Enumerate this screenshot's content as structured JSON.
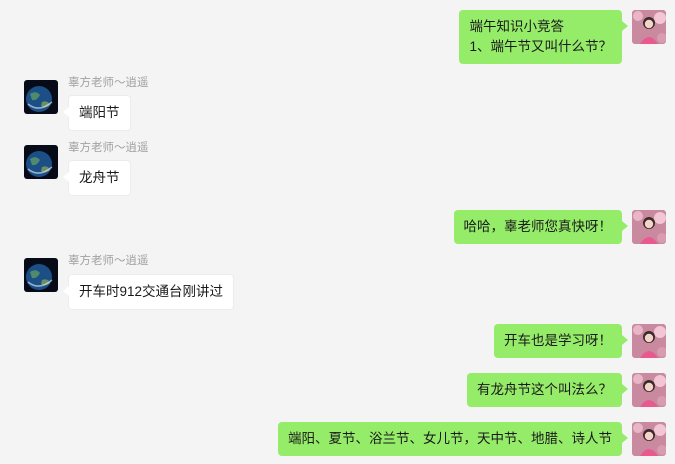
{
  "colors": {
    "background": "#f4f4f4",
    "outgoing_bubble": "#95ec69",
    "incoming_bubble": "#ffffff",
    "sender_name": "#a2a2a2"
  },
  "contact": {
    "sender_name": "辜方老师～逍遥",
    "avatar_icon": "earth-avatar-icon"
  },
  "self": {
    "avatar_icon": "pink-portrait-avatar-icon"
  },
  "messages": [
    {
      "direction": "out",
      "lines": [
        "端午知识小竞答",
        "1、端午节又叫什么节？"
      ]
    },
    {
      "direction": "in",
      "sender": "辜方老师～逍遥",
      "text": "端阳节"
    },
    {
      "direction": "in",
      "sender": "辜方老师～逍遥",
      "text": "龙舟节"
    },
    {
      "direction": "out",
      "text": "哈哈，辜老师您真快呀！"
    },
    {
      "direction": "in",
      "sender": "辜方老师～逍遥",
      "text": "开车时912交通台刚讲过"
    },
    {
      "direction": "out",
      "text": "开车也是学习呀！"
    },
    {
      "direction": "out",
      "text": "有龙舟节这个叫法么？"
    },
    {
      "direction": "out",
      "text": "端阳、夏节、浴兰节、女儿节，天中节、地腊、诗人节"
    }
  ]
}
